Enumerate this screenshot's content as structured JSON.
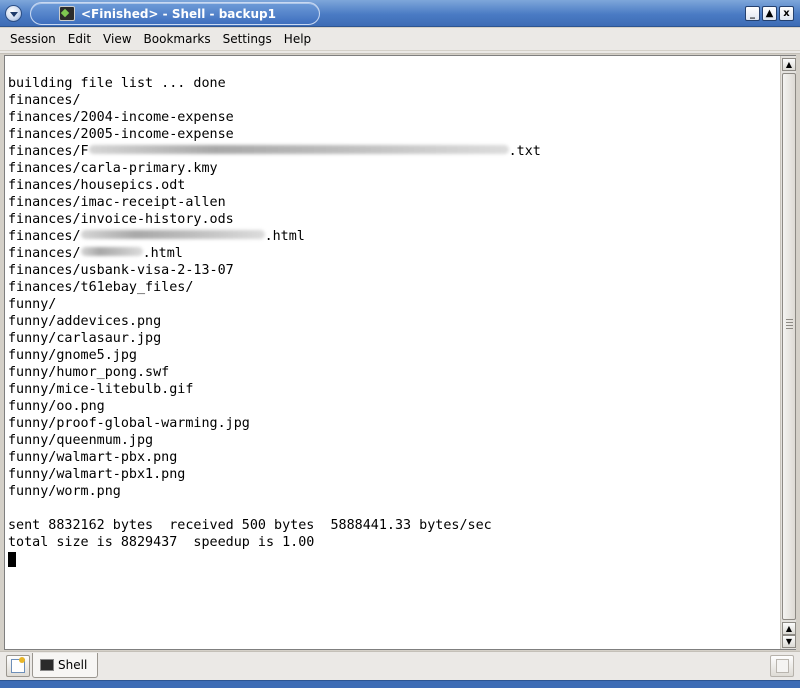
{
  "window": {
    "title": "<Finished> - Shell - backup1",
    "controls": {
      "minimize": "_",
      "maximize": "▲",
      "close": "x"
    }
  },
  "menubar": {
    "items": [
      "Session",
      "Edit",
      "View",
      "Bookmarks",
      "Settings",
      "Help"
    ]
  },
  "terminal": {
    "lines": [
      "building file list ... done",
      "finances/",
      "finances/2004-income-expense",
      "finances/2005-income-expense",
      "finances/F",
      "finances/carla-primary.kmy",
      "finances/housepics.odt",
      "finances/imac-receipt-allen",
      "finances/invoice-history.ods",
      "finances/",
      "finances/",
      "finances/usbank-visa-2-13-07",
      "finances/t61ebay_files/",
      "funny/",
      "funny/addevices.png",
      "funny/carlasaur.jpg",
      "funny/gnome5.jpg",
      "funny/humor_pong.swf",
      "funny/mice-litebulb.gif",
      "funny/oo.png",
      "funny/proof-global-warming.jpg",
      "funny/queenmum.jpg",
      "funny/walmart-pbx.png",
      "funny/walmart-pbx1.png",
      "funny/worm.png",
      "",
      "sent 8832162 bytes  received 500 bytes  5888441.33 bytes/sec",
      "total size is 8829437  speedup is 1.00"
    ],
    "redacted_suffixes": {
      "line_4": ".txt",
      "line_9": ".html",
      "line_10": ".html"
    }
  },
  "tabs": {
    "items": [
      {
        "label": "Shell",
        "icon": "terminal-icon"
      }
    ],
    "new_tab_icon": "new-tab-icon",
    "close_tab_icon": "close-tab-icon"
  },
  "colors": {
    "titlebar": "#4a7bc4",
    "chrome": "#ebe9e6",
    "terminal_bg": "#ffffff",
    "terminal_fg": "#000000"
  }
}
